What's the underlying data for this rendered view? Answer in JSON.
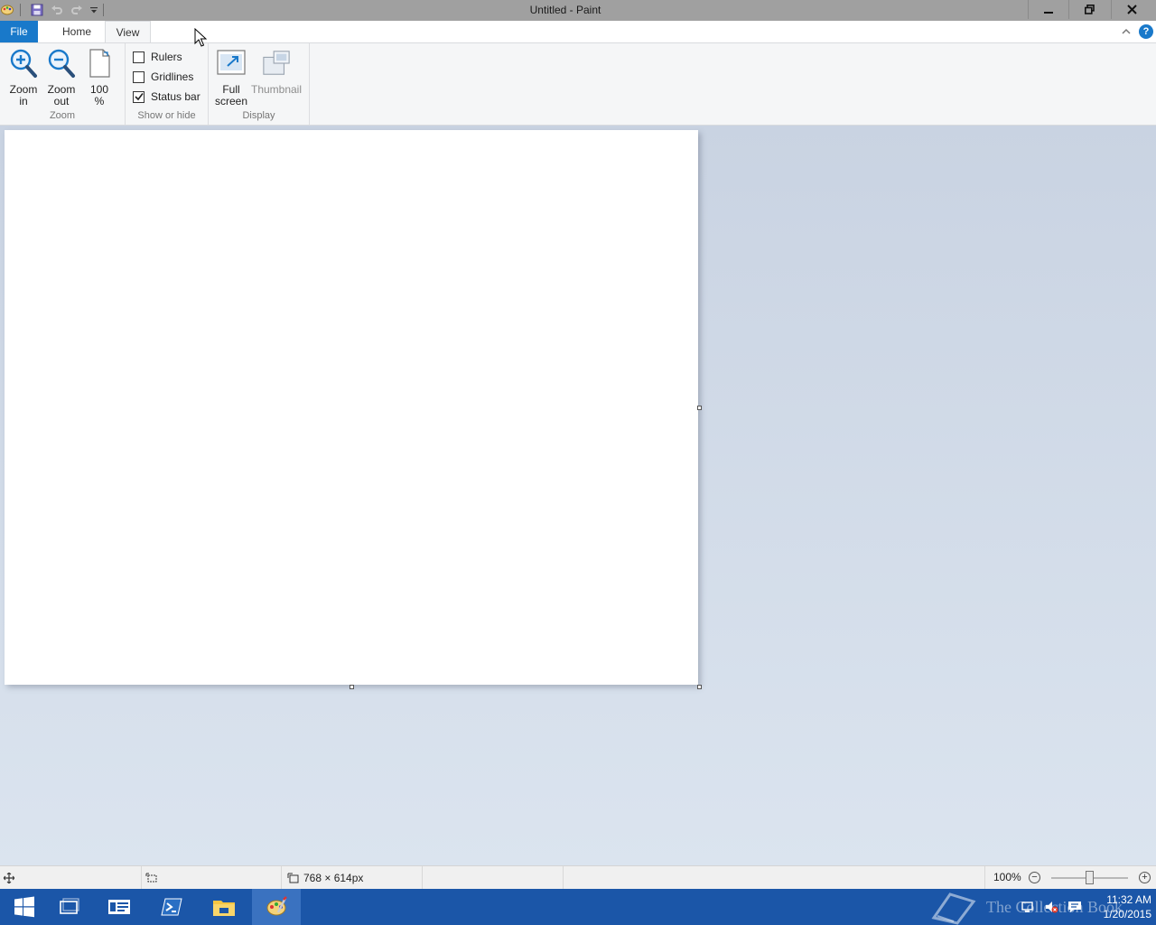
{
  "window": {
    "title": "Untitled - Paint"
  },
  "tabs": {
    "file": "File",
    "home": "Home",
    "view": "View"
  },
  "ribbon": {
    "zoom_group": {
      "zoom_in_line1": "Zoom",
      "zoom_in_line2": "in",
      "zoom_out_line1": "Zoom",
      "zoom_out_line2": "out",
      "hundred_line1": "100",
      "hundred_line2": "%",
      "label": "Zoom"
    },
    "show_hide_group": {
      "rulers": "Rulers",
      "rulers_checked": false,
      "gridlines": "Gridlines",
      "gridlines_checked": false,
      "status_bar": "Status bar",
      "status_bar_checked": true,
      "label": "Show or hide"
    },
    "display_group": {
      "full_screen_line1": "Full",
      "full_screen_line2": "screen",
      "thumbnail": "Thumbnail",
      "label": "Display"
    }
  },
  "help_glyph": "?",
  "statusbar": {
    "canvas_size": "768 × 614px",
    "zoom_level": "100%",
    "zoom_slider_value": 100
  },
  "taskbar": {
    "watermark": "The Collection Book",
    "clock_time": "11:32 AM",
    "clock_date": "1/20/2015"
  },
  "colors": {
    "accent": "#1979ca",
    "taskbar": "#1b56a8",
    "titlebar": "#a0a0a0"
  }
}
